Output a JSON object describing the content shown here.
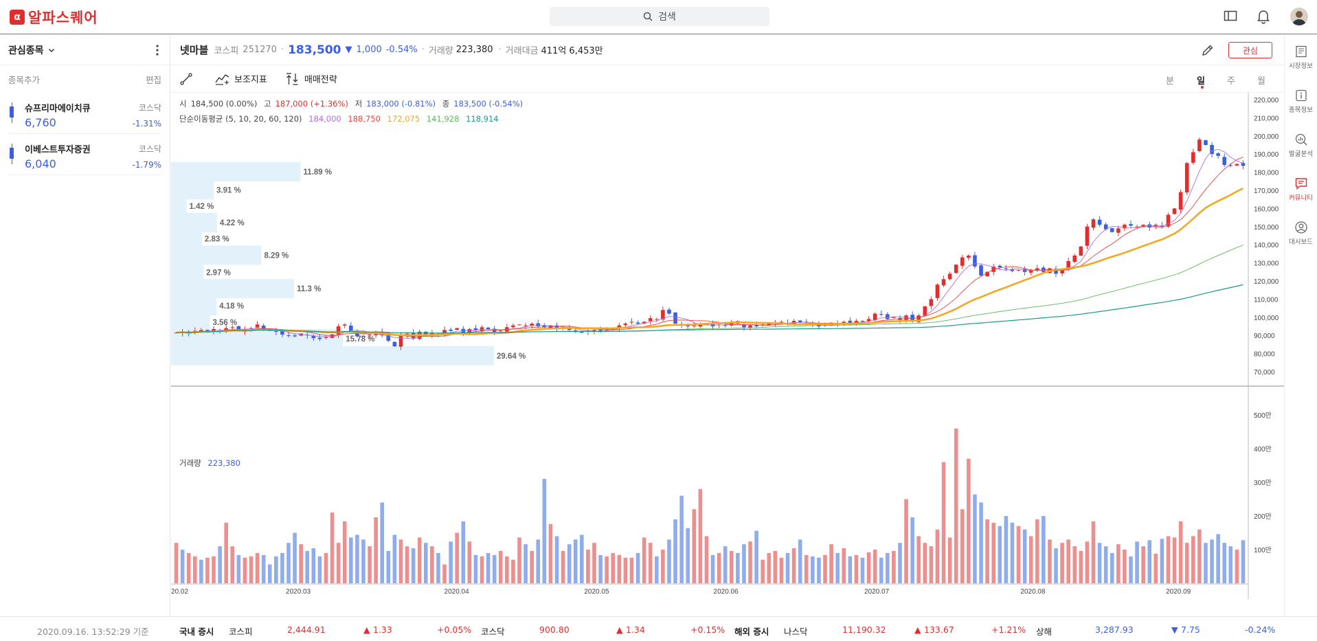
{
  "app": {
    "logo": "알파스퀘어",
    "search_placeholder": "검색"
  },
  "watchlist": {
    "title": "관심종목",
    "add_label": "종목추가",
    "edit_label": "편집",
    "items": [
      {
        "name": "슈프리마에이치큐",
        "market": "코스닥",
        "price": "6,760",
        "change": "-1.31%"
      },
      {
        "name": "이베스트투자증권",
        "market": "코스닥",
        "price": "6,040",
        "change": "-1.79%"
      }
    ],
    "as_of": "2020.09.16. 13:52:29 기준"
  },
  "stock": {
    "name": "넷마블",
    "market": "코스피",
    "code": "251270",
    "price": "183,500",
    "change": "1,000",
    "change_pct": "-0.54%",
    "volume_label": "거래량",
    "volume": "223,380",
    "amount_label": "거래대금",
    "amount": "411억 6,453만",
    "fav_label": "관심"
  },
  "toolbar": {
    "indicator_label": "보조지표",
    "strategy_label": "매매전략"
  },
  "periods": [
    "분",
    "일",
    "주",
    "월"
  ],
  "active_period": "일",
  "ohlc": {
    "open_label": "시",
    "open": "184,500 (0.00%)",
    "high_label": "고",
    "high": "187,000 (+1.36%)",
    "low_label": "저",
    "low": "183,000 (-0.81%)",
    "close_label": "종",
    "close": "183,500 (-0.54%)"
  },
  "ma": {
    "label": "단순이동평균 (5, 10, 20, 60, 120)",
    "values": [
      "184,000",
      "188,750",
      "172,075",
      "141,928",
      "118,914"
    ],
    "colors": [
      "#b36be0",
      "#e8423a",
      "#f5a623",
      "#5cb85c",
      "#159a8c"
    ]
  },
  "volume_panel": {
    "label": "거래량",
    "value": "223,380"
  },
  "chart_data": {
    "type": "candlestick",
    "price_axis": [
      "220,000",
      "210,000",
      "200,000",
      "190,000",
      "180,000",
      "170,000",
      "160,000",
      "150,000",
      "140,000",
      "130,000",
      "120,000",
      "110,000",
      "100,000",
      "90,000",
      "80,000",
      "70,000"
    ],
    "volume_axis": [
      "500만",
      "400만",
      "300만",
      "200만",
      "100만"
    ],
    "x_labels": [
      "20.02",
      "2020.03",
      "2020.04",
      "2020.05",
      "2020.06",
      "2020.07",
      "2020.08",
      "2020.09"
    ],
    "ylim": [
      65000,
      225000
    ],
    "volume_profile": [
      {
        "price": 203000,
        "pct": 11.89,
        "label": "11.89 %"
      },
      {
        "price": 193000,
        "pct": 3.91,
        "label": "3.91 %"
      },
      {
        "price": 184000,
        "pct": 1.42,
        "label": "1.42 %"
      },
      {
        "price": 175000,
        "pct": 4.22,
        "label": "4.22 %"
      },
      {
        "price": 166000,
        "pct": 2.83,
        "label": "2.83 %"
      },
      {
        "price": 157000,
        "pct": 8.29,
        "label": "8.29 %"
      },
      {
        "price": 147500,
        "pct": 2.97,
        "label": "2.97 %"
      },
      {
        "price": 138500,
        "pct": 11.3,
        "label": "11.3 %"
      },
      {
        "price": 129000,
        "pct": 4.18,
        "label": "4.18 %"
      },
      {
        "price": 120000,
        "pct": 3.56,
        "label": "3.56 %"
      },
      {
        "price": 111000,
        "pct": 15.78,
        "label": "15.78 %"
      },
      {
        "price": 101500,
        "pct": 29.64,
        "label": "29.64 %"
      }
    ],
    "closes": [
      91500,
      92000,
      91000,
      92500,
      93000,
      92000,
      93500,
      92500,
      94000,
      94500,
      92500,
      93500,
      94000,
      96000,
      93000,
      92500,
      92000,
      90500,
      90000,
      89500,
      91000,
      90000,
      88500,
      88000,
      89000,
      90500,
      95000,
      96000,
      92500,
      89500,
      89500,
      90500,
      92000,
      90000,
      87000,
      84000,
      90000,
      91000,
      88500,
      92000,
      90000,
      91500,
      90500,
      93000,
      92500,
      94000,
      91500,
      93500,
      93000,
      94500,
      93500,
      92000,
      92500,
      94500,
      95500,
      96000,
      95500,
      96500,
      95000,
      94500,
      95500,
      94000,
      94500,
      93000,
      92000,
      91500,
      92500,
      93000,
      92500,
      93500,
      94000,
      95500,
      96500,
      97500,
      96500,
      97500,
      99500,
      99000,
      104000,
      102000,
      96500,
      96000,
      95000,
      95500,
      96000,
      96500,
      95000,
      96000,
      95500,
      97500,
      96500,
      94500,
      95500,
      95000,
      96000,
      96500,
      97000,
      97500,
      96500,
      98000,
      97000,
      97500,
      96000,
      95000,
      96000,
      97000,
      96500,
      97500,
      96500,
      98000,
      97500,
      99000,
      102000,
      101500,
      99000,
      100000,
      98500,
      101000,
      98000,
      101000,
      106000,
      110000,
      118000,
      121000,
      124000,
      129000,
      133000,
      134000,
      128000,
      123000,
      125000,
      128000,
      127500,
      126500,
      125500,
      126000,
      125000,
      126000,
      127000,
      125000,
      127000,
      124000,
      126000,
      131000,
      134000,
      139000,
      150000,
      154000,
      151000,
      148500,
      147000,
      149000,
      151000,
      150500,
      150000,
      151000,
      149500,
      151000,
      150000,
      156500,
      160000,
      169000,
      185000,
      191000,
      198000,
      195000,
      190000,
      189000,
      184000,
      183500,
      184500,
      183500
    ],
    "volumes": [
      60,
      50,
      45,
      40,
      35,
      38,
      40,
      55,
      90,
      55,
      42,
      38,
      40,
      45,
      42,
      28,
      40,
      45,
      60,
      75,
      58,
      48,
      52,
      40,
      45,
      105,
      60,
      92,
      68,
      72,
      65,
      55,
      98,
      120,
      48,
      72,
      65,
      55,
      52,
      68,
      60,
      55,
      45,
      28,
      62,
      75,
      92,
      62,
      42,
      40,
      45,
      42,
      48,
      40,
      35,
      68,
      58,
      48,
      65,
      155,
      88,
      70,
      48,
      58,
      65,
      72,
      50,
      60,
      42,
      40,
      45,
      42,
      38,
      38,
      45,
      68,
      60,
      40,
      50,
      65,
      95,
      130,
      82,
      110,
      140,
      70,
      42,
      45,
      55,
      48,
      45,
      58,
      62,
      78,
      35,
      45,
      48,
      38,
      45,
      52,
      65,
      42,
      40,
      38,
      42,
      58,
      45,
      52,
      40,
      42,
      38,
      46,
      50,
      38,
      45,
      48,
      60,
      125,
      98,
      70,
      60,
      55,
      80,
      180,
      68,
      230,
      110,
      185,
      132,
      120,
      95,
      90,
      85,
      100,
      90,
      85,
      80,
      70,
      95,
      100,
      65,
      52,
      60,
      65,
      55,
      48,
      62,
      92,
      60,
      55,
      45,
      58,
      50,
      40,
      62,
      55,
      64,
      44,
      66,
      70,
      68,
      92,
      60,
      70,
      80,
      60,
      65,
      73,
      60,
      55,
      50,
      64,
      82,
      40,
      58,
      52,
      48,
      60,
      58,
      70,
      242,
      194,
      180,
      198,
      125,
      68,
      58
    ],
    "volumes_up": [
      true,
      false,
      true,
      true,
      false,
      true,
      true,
      false,
      true,
      true,
      false,
      true,
      true,
      true,
      false,
      false,
      false,
      false,
      false,
      false,
      true,
      false,
      false,
      false,
      true,
      true,
      true,
      true,
      false,
      false,
      false,
      true,
      true,
      false,
      false,
      false,
      true,
      true,
      false,
      true,
      false,
      true,
      false,
      true,
      false,
      true,
      false,
      true,
      false,
      true,
      false,
      false,
      true,
      true,
      true,
      true,
      false,
      true,
      false,
      false,
      true,
      false,
      true,
      false,
      false,
      false,
      true,
      true,
      false,
      true,
      true,
      true,
      true,
      true,
      false,
      true,
      true,
      false,
      true,
      false,
      false,
      false,
      false,
      true,
      true,
      true,
      false,
      true,
      false,
      true,
      false,
      false,
      true,
      false,
      true,
      true,
      true,
      true,
      false,
      true,
      false,
      true,
      false,
      false,
      true,
      true,
      false,
      true,
      false,
      true,
      false,
      true,
      true,
      false,
      false,
      true,
      false,
      true,
      false,
      true,
      true,
      true,
      true,
      true,
      true,
      true,
      true,
      true,
      false,
      false,
      true,
      true,
      false,
      false,
      false,
      true,
      false,
      true,
      true,
      false,
      true,
      false,
      true,
      true,
      true,
      true,
      true,
      true,
      false,
      false,
      false,
      true,
      true,
      false,
      false,
      true,
      false,
      true,
      false,
      true,
      true,
      true,
      true,
      true,
      true,
      false,
      false,
      false,
      false,
      false,
      true,
      false
    ]
  },
  "footer": {
    "domestic_label": "국내 증시",
    "kospi_label": "코스피",
    "kospi_value": "2,444.91",
    "kospi_change": "1.33",
    "kospi_pct": "+0.05%",
    "kosdaq_label": "코스닥",
    "kosdaq_value": "900.80",
    "kosdaq_change": "1.34",
    "kosdaq_pct": "+0.15%",
    "overseas_label": "해외 증시",
    "nasdaq_label": "나스닥",
    "nasdaq_value": "11,190.32",
    "nasdaq_change": "133.67",
    "nasdaq_pct": "+1.21%",
    "shanghai_label": "상해",
    "shanghai_value": "3,287.93",
    "shanghai_change": "7.75",
    "shanghai_pct": "-0.24%"
  },
  "right_nav": [
    {
      "label": "시장정보",
      "icon": "newspaper-icon"
    },
    {
      "label": "종목정보",
      "icon": "info-icon"
    },
    {
      "label": "발굴분석",
      "icon": "chart-search-icon"
    },
    {
      "label": "커뮤니티",
      "icon": "chat-icon",
      "active": true
    },
    {
      "label": "대시보드",
      "icon": "user-circle-icon"
    }
  ]
}
